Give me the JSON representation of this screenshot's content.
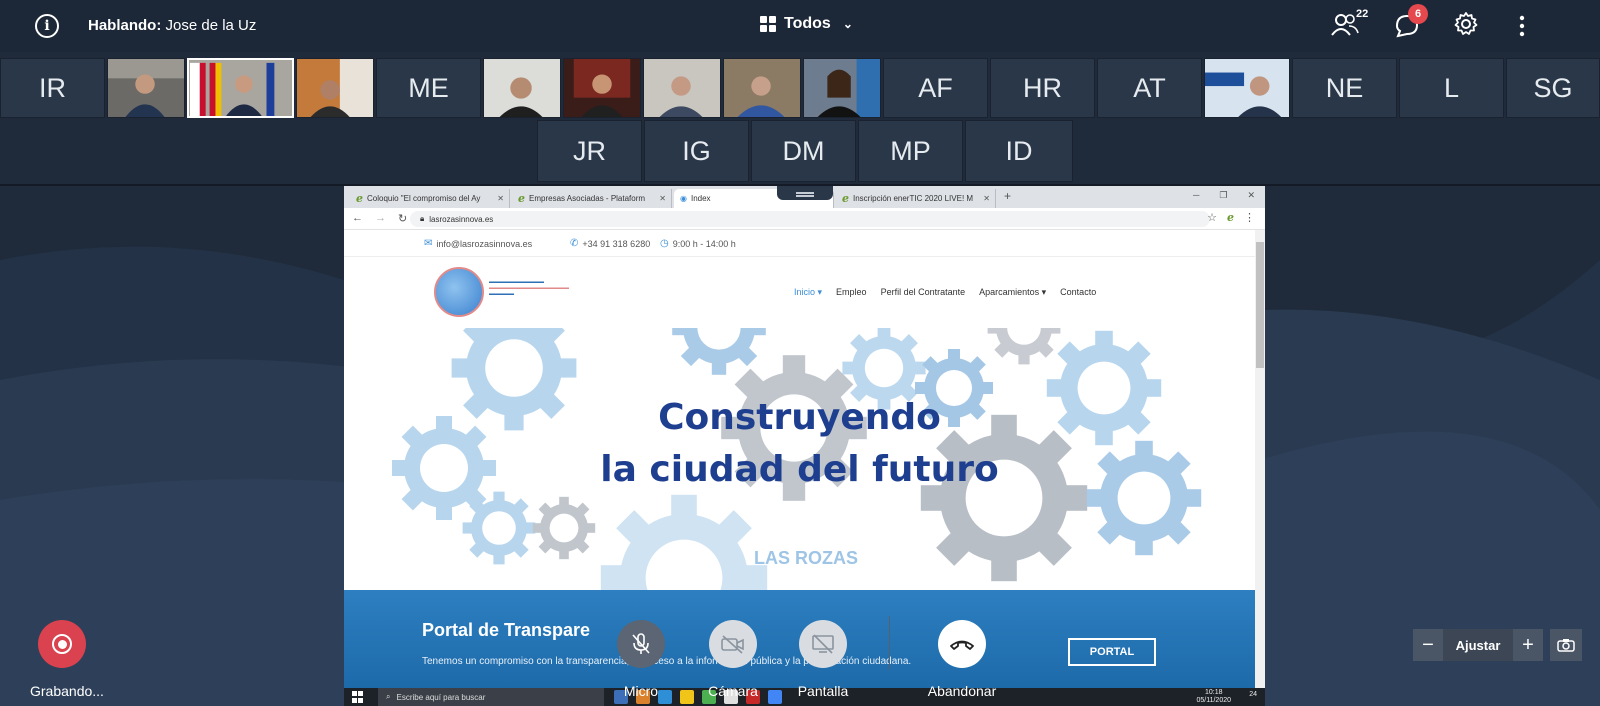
{
  "topbar": {
    "speaking_label": "Hablando:",
    "speaking_name": "Jose de la Uz",
    "layout_label": "Todos",
    "participants_count": "22",
    "chat_count": "6"
  },
  "participants_row1": [
    {
      "kind": "initials",
      "label": "IR"
    },
    {
      "kind": "video"
    },
    {
      "kind": "video"
    },
    {
      "kind": "video"
    },
    {
      "kind": "initials",
      "label": "ME"
    },
    {
      "kind": "video"
    },
    {
      "kind": "video"
    },
    {
      "kind": "video"
    },
    {
      "kind": "video"
    },
    {
      "kind": "video"
    },
    {
      "kind": "initials",
      "label": "AF"
    },
    {
      "kind": "initials",
      "label": "HR"
    },
    {
      "kind": "initials",
      "label": "AT"
    },
    {
      "kind": "video"
    },
    {
      "kind": "initials",
      "label": "NE"
    },
    {
      "kind": "initials",
      "label": "L"
    },
    {
      "kind": "initials",
      "label": "SG"
    }
  ],
  "participants_row2": [
    "JR",
    "IG",
    "DM",
    "MP",
    "ID"
  ],
  "browser": {
    "tabs": [
      "Coloquio \"El compromiso del Ay",
      "Empresas Asociadas - Plataform",
      "Index",
      "Inscripción enerTIC 2020 LIVE! M"
    ],
    "url": "lasrozasinnova.es"
  },
  "site": {
    "email": "info@lasrozasinnova.es",
    "phone": "+34 91 318 6280",
    "hours": "9:00 h - 14:00 h",
    "menu": [
      "Inicio",
      "Empleo",
      "Perfil del Contratante",
      "Aparcamientos",
      "Contacto"
    ],
    "hero_line1": "Construyendo",
    "hero_line2": "la ciudad del futuro",
    "hero_watermark": "LAS ROZAS",
    "portal_title": "Portal de Transpare",
    "portal_desc": "Tenemos un compromiso con la transparencia, el acceso a la información pública y la participación ciudadana.",
    "portal_button": "PORTAL"
  },
  "taskbar": {
    "search_placeholder": "Escribe aquí para buscar",
    "time": "10:18",
    "date": "05/11/2020",
    "notif_count": "24"
  },
  "controls": {
    "recording": "Grabando...",
    "mic": "Micro",
    "camera": "Cámara",
    "screen": "Pantalla",
    "leave": "Abandonar",
    "fit": "Ajustar"
  },
  "colors": {
    "background": "#1f2b3b",
    "record_red": "#d9424e",
    "chat_badge": "#e5484d",
    "hero_title": "#1e3f8f",
    "portal_blue": "#2d7fc1"
  }
}
